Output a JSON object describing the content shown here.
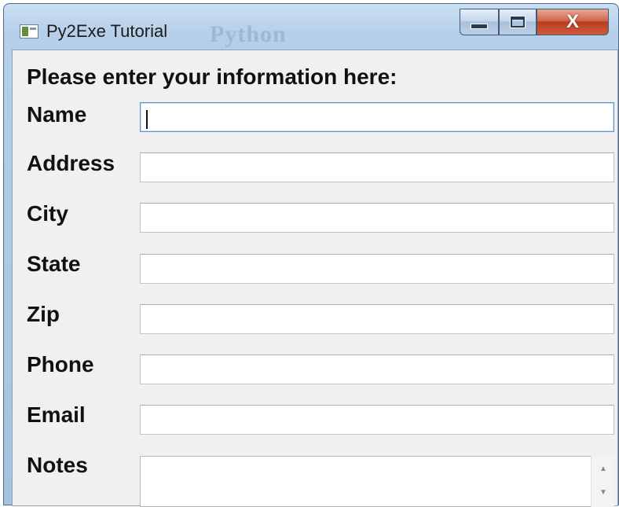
{
  "window": {
    "title": "Py2Exe Tutorial",
    "background_watermark": "Python",
    "icon": "app-window-icon",
    "controls": {
      "minimize_icon": "minimize-icon",
      "maximize_icon": "maximize-icon",
      "close_label": "X"
    }
  },
  "form": {
    "heading": "Please enter your information here:",
    "fields": [
      {
        "label": "Name",
        "value": "",
        "focused": true
      },
      {
        "label": "Address",
        "value": ""
      },
      {
        "label": "City",
        "value": ""
      },
      {
        "label": "State",
        "value": ""
      },
      {
        "label": "Zip",
        "value": ""
      },
      {
        "label": "Phone",
        "value": ""
      },
      {
        "label": "Email",
        "value": ""
      }
    ],
    "notes": {
      "label": "Notes",
      "value": ""
    }
  },
  "colors": {
    "title_bar": "#b6cfe8",
    "close_button": "#c9472b",
    "client_bg": "#f0f0f0",
    "focus_border": "#5e95c9"
  }
}
